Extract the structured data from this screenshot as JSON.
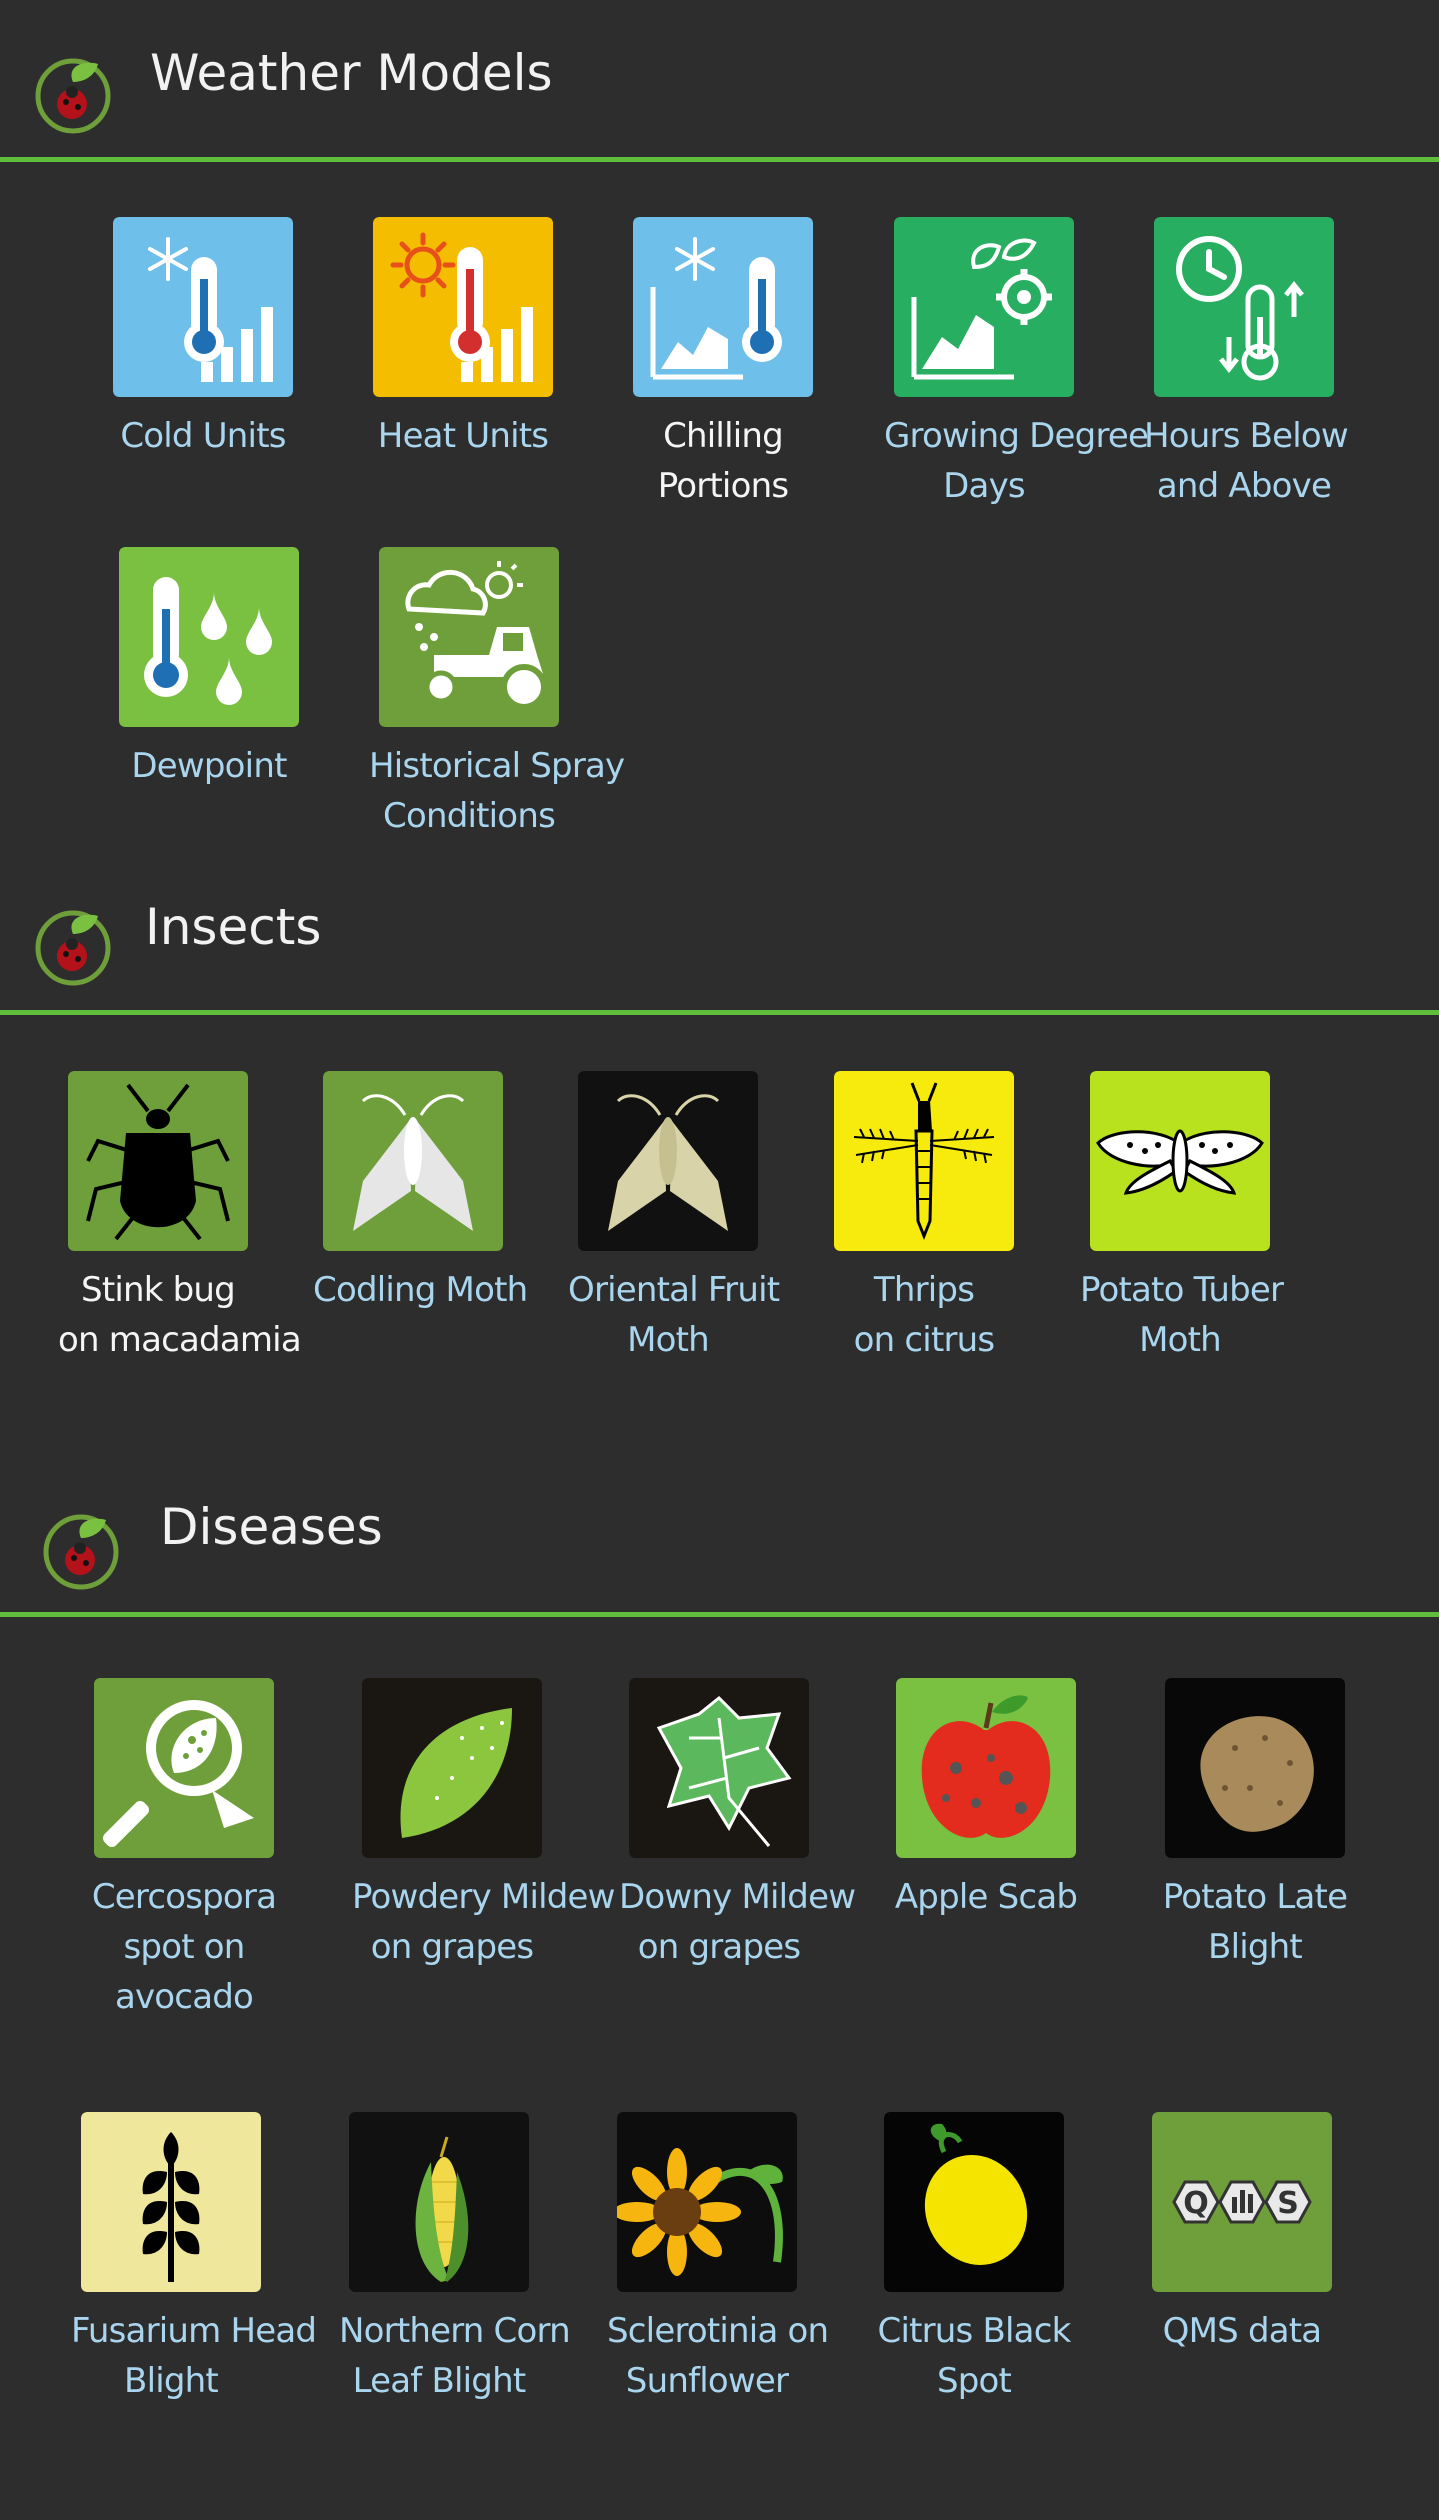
{
  "sections": {
    "weather": {
      "title": "Weather Models",
      "tiles": [
        {
          "line1": "Cold Units",
          "line2": ""
        },
        {
          "line1": "Heat Units",
          "line2": ""
        },
        {
          "line1": "Chilling",
          "line2": "Portions"
        },
        {
          "line1": "Growing Degree",
          "line2": "Days"
        },
        {
          "line1": "Hours Below",
          "line2": "and Above"
        },
        {
          "line1": "Dewpoint",
          "line2": ""
        },
        {
          "line1": "Historical Spray",
          "line2": "Conditions"
        }
      ]
    },
    "insects": {
      "title": "Insects",
      "tiles": [
        {
          "line1": "Stink bug",
          "line2": "on macadamia"
        },
        {
          "line1": "Codling Moth",
          "line2": ""
        },
        {
          "line1": "Oriental Fruit",
          "line2": "Moth"
        },
        {
          "line1": "Thrips",
          "line2": "on citrus"
        },
        {
          "line1": "Potato Tuber",
          "line2": "Moth"
        }
      ]
    },
    "diseases": {
      "title": "Diseases",
      "tiles": [
        {
          "line1": "Cercospora",
          "line2": "spot on",
          "line3": "avocado"
        },
        {
          "line1": "Powdery Mildew",
          "line2": "on grapes"
        },
        {
          "line1": "Downy Mildew",
          "line2": "on grapes"
        },
        {
          "line1": "Apple Scab",
          "line2": ""
        },
        {
          "line1": "Potato Late",
          "line2": "Blight"
        },
        {
          "line1": "Fusarium Head",
          "line2": "Blight"
        },
        {
          "line1": "Northern Corn",
          "line2": "Leaf Blight"
        },
        {
          "line1": "Sclerotinia on",
          "line2": "Sunflower"
        },
        {
          "line1": "Citrus Black",
          "line2": "Spot"
        },
        {
          "line1": "QMS data",
          "line2": ""
        }
      ]
    }
  },
  "icon_text": {
    "qms": [
      "Q",
      "S"
    ]
  },
  "colors": {
    "accent_green": "#5fbf3c",
    "label_blue": "#a9d5ee",
    "cold_blue": "#6ec0ea",
    "heat_yellow": "#f5bd00",
    "bright_green": "#27ae60",
    "lime_green": "#7ac142",
    "olive_green": "#6f9f3a",
    "thrips_yellow": "#f7ea0d",
    "moth_lime": "#b8e21e",
    "fusarium_cream": "#efe79c"
  }
}
